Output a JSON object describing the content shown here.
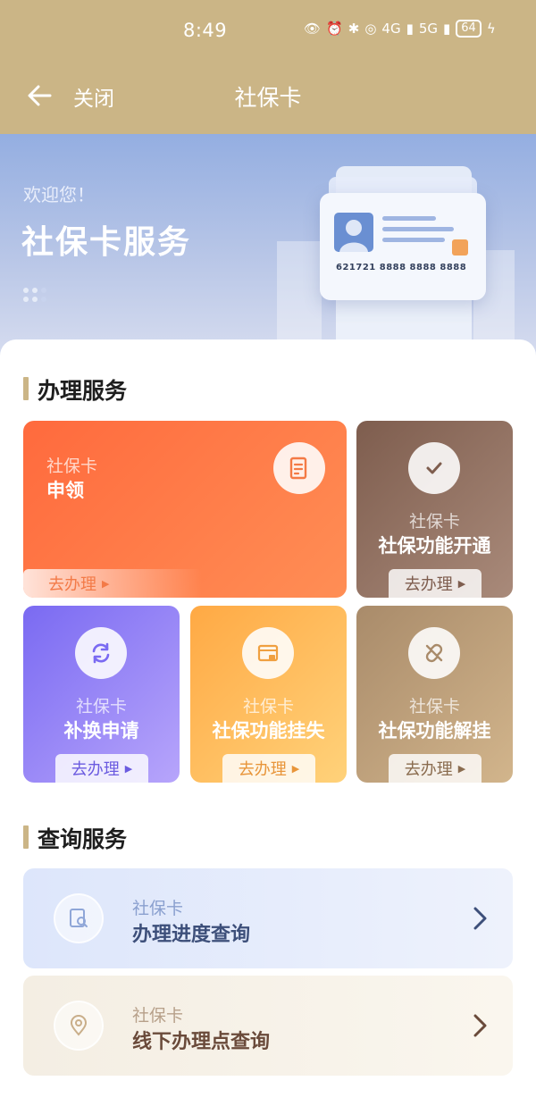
{
  "status": {
    "time": "8:49",
    "net1": "4G",
    "net2": "5G",
    "battery": "64"
  },
  "nav": {
    "close_label": "关闭",
    "title": "社保卡"
  },
  "banner": {
    "welcome": "欢迎您！",
    "title": "社保卡服务",
    "card_number": "621721 8888 8888 8888"
  },
  "handle": {
    "title": "办理服务",
    "go_label": "去办理",
    "items": [
      {
        "sub": "社保卡",
        "main": "申领",
        "icon": "document-icon"
      },
      {
        "sub": "社保卡",
        "main": "社保功能开通",
        "icon": "check-icon"
      },
      {
        "sub": "社保卡",
        "main": "补换申请",
        "icon": "refresh-icon"
      },
      {
        "sub": "社保卡",
        "main": "社保功能挂失",
        "icon": "lock-card-icon"
      },
      {
        "sub": "社保卡",
        "main": "社保功能解挂",
        "icon": "unlink-icon"
      }
    ]
  },
  "query": {
    "title": "查询服务",
    "items": [
      {
        "sub": "社保卡",
        "main": "办理进度查询",
        "icon": "search-doc-icon"
      },
      {
        "sub": "社保卡",
        "main": "线下办理点查询",
        "icon": "location-icon"
      }
    ]
  },
  "colors": {
    "brand": "#cbb586",
    "orange": "#ff7a45",
    "purple": "#8b7af5",
    "gold": "#ffb74a",
    "brown": "#8f6a58"
  }
}
